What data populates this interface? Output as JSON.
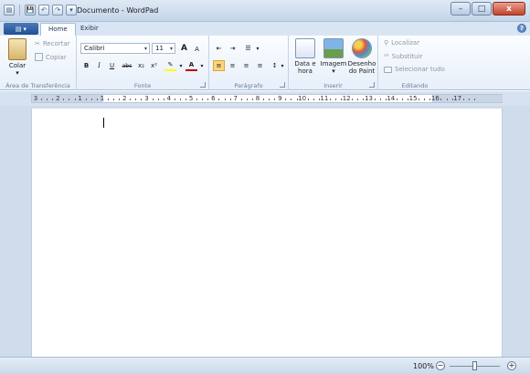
{
  "window": {
    "title": "Documento - WordPad",
    "controls": {
      "minimize": "–",
      "maximize": "□",
      "close": "x"
    }
  },
  "quick_access": {
    "save_icon": "💾",
    "undo_icon": "↶",
    "redo_icon": "↷",
    "dropdown_icon": "▾"
  },
  "tabs": [
    {
      "label": "Home",
      "active": true
    },
    {
      "label": "Exibir",
      "active": false
    }
  ],
  "app_menu_label": "▾",
  "help_label": "?",
  "ribbon": {
    "clipboard": {
      "label": "Área de Transferência",
      "paste": "Colar",
      "paste_arrow": "▾",
      "cut": "Recortar",
      "copy": "Copiar"
    },
    "font": {
      "label": "Fonte",
      "family": "Calibri",
      "size": "11",
      "grow": "A",
      "shrink": "A",
      "bold": "B",
      "italic": "I",
      "underline": "U",
      "strike": "abc",
      "subscript": "x₂",
      "superscript": "x²",
      "highlight": "✎",
      "color": "A"
    },
    "paragraph": {
      "label": "Parágrafo",
      "decrease_indent": "⇤",
      "increase_indent": "⇥",
      "list": "☰",
      "align_left": "≡",
      "align_center": "≡",
      "align_right": "≡",
      "justify": "≡",
      "line_spacing": "↕"
    },
    "insert": {
      "label": "Inserir",
      "picture_top": "Imagem",
      "picture_arrow": "▾",
      "paint_top": "Desenho",
      "paint_bottom": "do Paint",
      "date_top": "Data e",
      "date_bottom": "hora"
    },
    "editing": {
      "label": "Editando",
      "find": "Localizar",
      "replace": "Substituir",
      "select_all": "Selecionar tudo"
    }
  },
  "ruler": {
    "marks": [
      "3",
      "2",
      "1",
      "1",
      "2",
      "3",
      "4",
      "5",
      "6",
      "7",
      "8",
      "9",
      "10",
      "11",
      "12",
      "13",
      "14",
      "15",
      "16",
      "17"
    ]
  },
  "status": {
    "zoom": "100%",
    "zoom_out": "−",
    "zoom_in": "+",
    "zoom_level": 0.5
  },
  "colors": {
    "accent": "#1f4f95",
    "selected": "#fbd67a",
    "font_color_underline": "#c00000",
    "highlight_underline": "#ffff00"
  }
}
